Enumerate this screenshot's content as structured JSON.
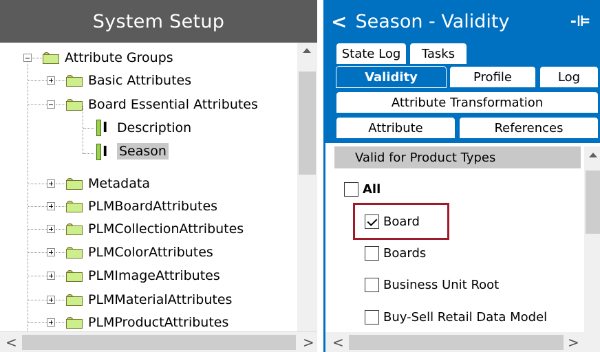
{
  "left_panel": {
    "title": "System Setup",
    "tree": {
      "root": "Attribute Groups",
      "basic": "Basic Attributes",
      "board_essential": "Board Essential Attributes",
      "description": "Description",
      "season": "Season",
      "metadata": "Metadata",
      "plm_board": "PLMBoardAttributes",
      "plm_collection": "PLMCollectionAttributes",
      "plm_color": "PLMColorAttributes",
      "plm_image": "PLMImageAttributes",
      "plm_material": "PLMMaterialAttributes",
      "plm_product": "PLMProductAttributes"
    },
    "scroll_left": "<",
    "scroll_right": ">"
  },
  "right_panel": {
    "title": "Season - Validity",
    "back": "<",
    "pin": "-⊫",
    "tabs": {
      "state_log": "State Log",
      "tasks": "Tasks",
      "validity": "Validity",
      "profile": "Profile",
      "log": "Log",
      "attribute_transformation": "Attribute Transformation",
      "attribute": "Attribute",
      "references": "References"
    },
    "section_header": "Valid for Product Types",
    "section_icon": "⚲",
    "all_label": "All",
    "items": {
      "board": "Board",
      "boards": "Boards",
      "business_unit_root": "Business Unit Root",
      "buy_sell": "Buy-Sell Retail Data Model"
    },
    "scroll_left": "<",
    "scroll_right": ">"
  },
  "colors": {
    "accent": "#0070c0",
    "left_title_bg": "#5b5b5b",
    "highlight_border": "#9e1c2a"
  }
}
